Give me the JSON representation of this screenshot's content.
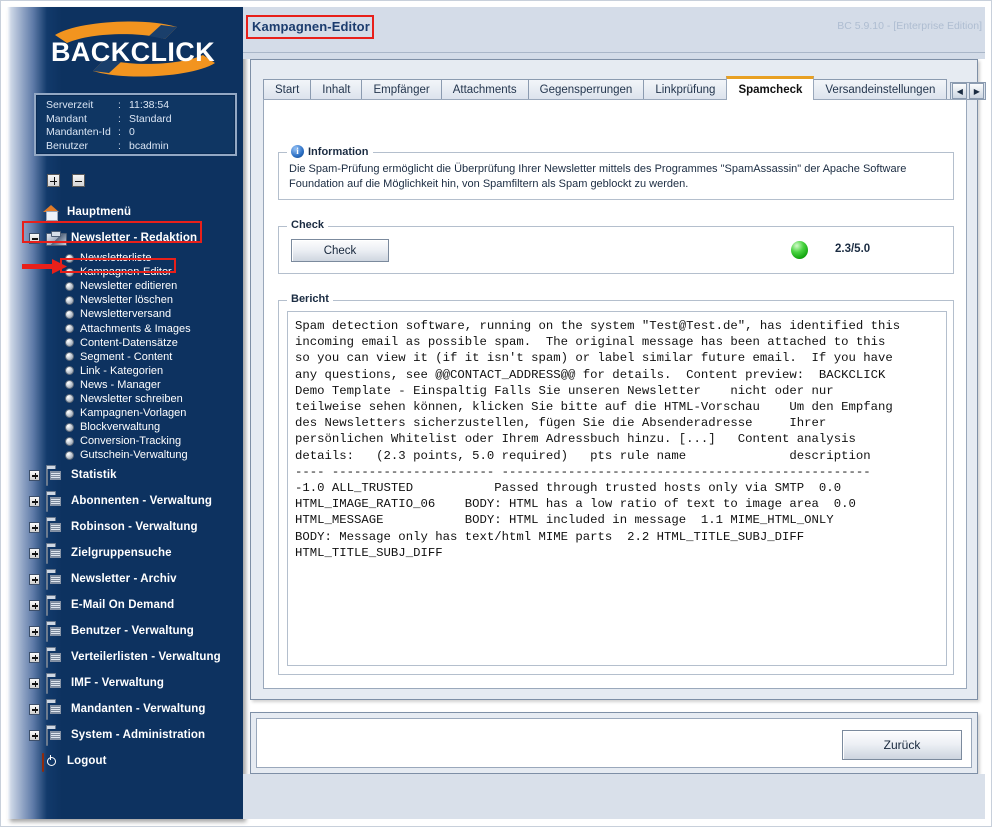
{
  "header": {
    "page_title": "Kampagnen-Editor",
    "version_text": "BC 5.9.10 - [Enterprise Edition]"
  },
  "sidebar": {
    "logo_text": "BACKCLICK",
    "server_info": [
      {
        "label": "Serverzeit",
        "colon": ":",
        "value": "11:38:54"
      },
      {
        "label": "Mandant",
        "colon": ":",
        "value": "Standard"
      },
      {
        "label": "Mandanten-Id",
        "colon": ":",
        "value": "0"
      },
      {
        "label": "Benutzer",
        "colon": ":",
        "value": "bcadmin"
      }
    ],
    "expand_all_icon": "plus-box-icon",
    "collapse_all_icon": "minus-box-icon",
    "nav": [
      {
        "label": "Hauptmenü",
        "icon": "house-icon",
        "toggle": "none",
        "expanded": false,
        "children": []
      },
      {
        "label": "Newsletter - Redaktion",
        "icon": "newsletter-icon",
        "toggle": "minus",
        "expanded": true,
        "children": [
          "Newsletterliste",
          "Kampagnen-Editor",
          "Newsletter editieren",
          "Newsletter löschen",
          "Newsletterversand",
          "Attachments & Images",
          "Content-Datensätze",
          "Segment - Content",
          "Link - Kategorien",
          "News - Manager",
          "Newsletter schreiben",
          "Kampagnen-Vorlagen",
          "Blockverwaltung",
          "Conversion-Tracking",
          "Gutschein-Verwaltung"
        ]
      },
      {
        "label": "Statistik",
        "icon": "folder-icon",
        "toggle": "plus",
        "expanded": false,
        "children": []
      },
      {
        "label": "Abonnenten - Verwaltung",
        "icon": "folder-icon",
        "toggle": "plus",
        "expanded": false,
        "children": []
      },
      {
        "label": "Robinson - Verwaltung",
        "icon": "folder-icon",
        "toggle": "plus",
        "expanded": false,
        "children": []
      },
      {
        "label": "Zielgruppensuche",
        "icon": "folder-icon",
        "toggle": "plus",
        "expanded": false,
        "children": []
      },
      {
        "label": "Newsletter - Archiv",
        "icon": "folder-icon",
        "toggle": "plus",
        "expanded": false,
        "children": []
      },
      {
        "label": "E-Mail On Demand",
        "icon": "folder-icon",
        "toggle": "plus",
        "expanded": false,
        "children": []
      },
      {
        "label": "Benutzer - Verwaltung",
        "icon": "folder-icon",
        "toggle": "plus",
        "expanded": false,
        "children": []
      },
      {
        "label": "Verteilerlisten - Verwaltung",
        "icon": "folder-icon",
        "toggle": "plus",
        "expanded": false,
        "children": []
      },
      {
        "label": "IMF - Verwaltung",
        "icon": "folder-icon",
        "toggle": "plus",
        "expanded": false,
        "children": []
      },
      {
        "label": "Mandanten - Verwaltung",
        "icon": "folder-icon",
        "toggle": "plus",
        "expanded": false,
        "children": []
      },
      {
        "label": "System - Administration",
        "icon": "folder-icon",
        "toggle": "plus",
        "expanded": false,
        "children": []
      },
      {
        "label": "Logout",
        "icon": "logout-icon",
        "toggle": "none",
        "expanded": false,
        "children": []
      }
    ],
    "active_sub_item": "Kampagnen-Editor"
  },
  "tabs": {
    "items": [
      {
        "label": "Start",
        "active": false
      },
      {
        "label": "Inhalt",
        "active": false
      },
      {
        "label": "Empfänger",
        "active": false
      },
      {
        "label": "Attachments",
        "active": false
      },
      {
        "label": "Gegensperrungen",
        "active": false
      },
      {
        "label": "Linkprüfung",
        "active": false
      },
      {
        "label": "Spamcheck",
        "active": true
      },
      {
        "label": "Versandeinstellungen",
        "active": false
      }
    ],
    "scroll_left_glyph": "◀",
    "scroll_right_glyph": "▶",
    "active_tab_accent": "#e8a023"
  },
  "panels": {
    "information": {
      "legend": "Information",
      "icon": "info-circle-icon",
      "text": "Die Spam-Prüfung ermöglicht die Überprüfung Ihrer Newsletter mittels des Programmes \"SpamAssassin\" der Apache Software Foundation auf die Möglichkeit hin, von Spamfiltern als Spam geblockt zu werden."
    },
    "check": {
      "legend": "Check",
      "button_label": "Check",
      "status_color": "#2fbd28",
      "status_icon": "green-status-light-icon",
      "score": "2.3/5.0"
    },
    "report": {
      "legend": "Bericht",
      "text": "Spam detection software, running on the system \"Test@Test.de\", has identified this\nincoming email as possible spam.  The original message has been attached to this\nso you can view it (if it isn't spam) or label similar future email.  If you have\nany questions, see @@CONTACT_ADDRESS@@ for details.  Content preview:  BACKCLICK\nDemo Template - Einspaltig Falls Sie unseren Newsletter    nicht oder nur\nteilweise sehen können, klicken Sie bitte auf die HTML-Vorschau    Um den Empfang\ndes Newsletters sicherzustellen, fügen Sie die Absenderadresse     Ihrer\npersönlichen Whitelist oder Ihrem Adressbuch hinzu. [...]   Content analysis\ndetails:   (2.3 points, 5.0 required)   pts rule name              description\n---- ---------------------- --------------------------------------------------\n-1.0 ALL_TRUSTED           Passed through trusted hosts only via SMTP  0.0\nHTML_IMAGE_RATIO_06    BODY: HTML has a low ratio of text to image area  0.0\nHTML_MESSAGE           BODY: HTML included in message  1.1 MIME_HTML_ONLY\nBODY: Message only has text/html MIME parts  2.2 HTML_TITLE_SUBJ_DIFF\nHTML_TITLE_SUBJ_DIFF"
    }
  },
  "footer": {
    "back_button_label": "Zurück"
  },
  "annotations": {
    "color": "#e8201a",
    "boxes": [
      {
        "name": "page-title-highlight"
      },
      {
        "name": "newsletter-redaktion-highlight"
      },
      {
        "name": "kampagnen-editor-highlight"
      }
    ],
    "arrow": {
      "name": "pointer-arrow",
      "points_to": "Kampagnen-Editor"
    }
  }
}
